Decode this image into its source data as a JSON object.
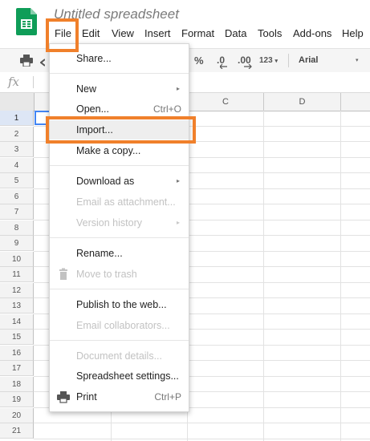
{
  "app": {
    "title": "Untitled spreadsheet",
    "logo_icon": "sheets-logo-icon"
  },
  "menubar": {
    "items": [
      {
        "label": "File"
      },
      {
        "label": "Edit"
      },
      {
        "label": "View"
      },
      {
        "label": "Insert"
      },
      {
        "label": "Format"
      },
      {
        "label": "Data"
      },
      {
        "label": "Tools"
      },
      {
        "label": "Add-ons"
      },
      {
        "label": "Help"
      }
    ]
  },
  "toolbar": {
    "percent_label": "%",
    "decimal_decrease_label": ".0",
    "decimal_increase_label": ".00",
    "number_format_label": "123",
    "font_label": "Arial"
  },
  "formula_bar": {
    "fx_label": "fx"
  },
  "grid": {
    "columns": [
      "C",
      "D"
    ],
    "rows": [
      "1",
      "2",
      "3",
      "4",
      "5",
      "6",
      "7",
      "8",
      "9",
      "10",
      "11",
      "12",
      "13",
      "14",
      "15",
      "16",
      "17",
      "18",
      "19",
      "20",
      "21"
    ]
  },
  "file_menu": {
    "items": [
      {
        "label": "Share...",
        "shortcut": "",
        "submenu": false,
        "disabled": false
      },
      {
        "label": "New",
        "shortcut": "",
        "submenu": true,
        "disabled": false
      },
      {
        "label": "Open...",
        "shortcut": "Ctrl+O",
        "submenu": false,
        "disabled": false
      },
      {
        "label": "Import...",
        "shortcut": "",
        "submenu": false,
        "disabled": false
      },
      {
        "label": "Make a copy...",
        "shortcut": "",
        "submenu": false,
        "disabled": false
      },
      {
        "label": "Download as",
        "shortcut": "",
        "submenu": true,
        "disabled": false
      },
      {
        "label": "Email as attachment...",
        "shortcut": "",
        "submenu": false,
        "disabled": true
      },
      {
        "label": "Version history",
        "shortcut": "",
        "submenu": true,
        "disabled": true
      },
      {
        "label": "Rename...",
        "shortcut": "",
        "submenu": false,
        "disabled": false
      },
      {
        "label": "Move to trash",
        "shortcut": "",
        "submenu": false,
        "disabled": true
      },
      {
        "label": "Publish to the web...",
        "shortcut": "",
        "submenu": false,
        "disabled": false
      },
      {
        "label": "Email collaborators...",
        "shortcut": "",
        "submenu": false,
        "disabled": true
      },
      {
        "label": "Document details...",
        "shortcut": "",
        "submenu": false,
        "disabled": true
      },
      {
        "label": "Spreadsheet settings...",
        "shortcut": "",
        "submenu": false,
        "disabled": false
      },
      {
        "label": "Print",
        "shortcut": "Ctrl+P",
        "submenu": false,
        "disabled": false
      }
    ]
  },
  "colors": {
    "highlight": "#f0802b",
    "sheets_green": "#0f9d58",
    "selection_blue": "#4285f4"
  }
}
